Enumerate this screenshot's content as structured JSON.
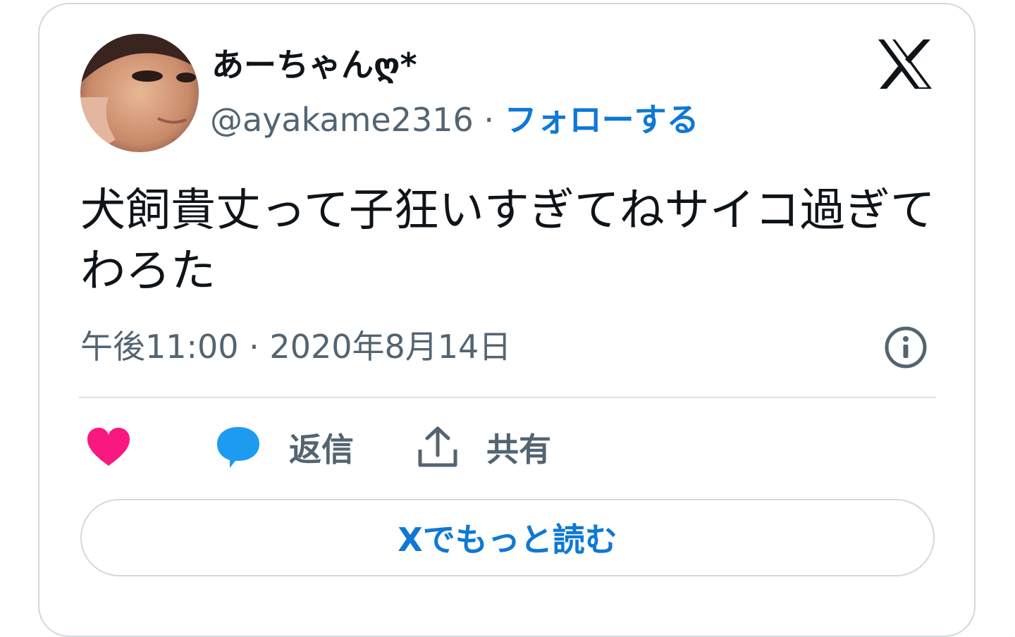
{
  "user": {
    "display_name": "あーちゃんღ*",
    "handle": "@ayakame2316",
    "separator": " · ",
    "follow_label": "フォローする"
  },
  "tweet": {
    "text": "犬飼貴丈って子狂いすぎてねサイコ過ぎてわろた",
    "timestamp": "午後11:00 · 2020年8月14日"
  },
  "actions": {
    "like_icon": "heart-icon",
    "reply_icon": "speech-bubble-icon",
    "reply_label": "返信",
    "share_icon": "share-icon",
    "share_label": "共有"
  },
  "read_more_label": "Xでもっと読む",
  "colors": {
    "like": "#f91880",
    "reply": "#1d9bf0",
    "link": "#0f78d4",
    "text": "#0f1419",
    "secondary": "#536471",
    "border": "#cfd9de"
  }
}
